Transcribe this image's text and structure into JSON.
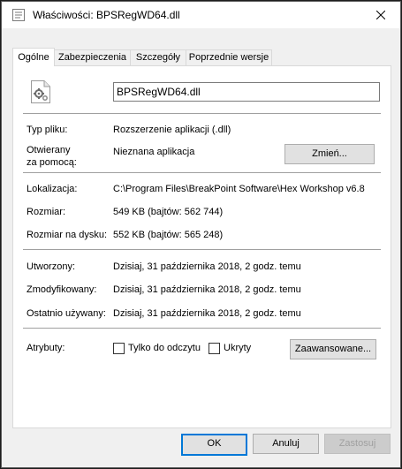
{
  "window": {
    "title": "Właściwości: BPSRegWD64.dll"
  },
  "tabs": [
    {
      "label": "Ogólne",
      "active": true
    },
    {
      "label": "Zabezpieczenia",
      "active": false
    },
    {
      "label": "Szczegóły",
      "active": false
    },
    {
      "label": "Poprzednie wersje",
      "active": false
    }
  ],
  "general": {
    "file_name": "BPSRegWD64.dll",
    "file_icon": "dll-file-icon",
    "type_label": "Typ pliku:",
    "type_value": "Rozszerzenie aplikacji (.dll)",
    "opens_with_label_line1": "Otwierany",
    "opens_with_label_line2": "za pomocą:",
    "opens_with_value": "Nieznana aplikacja",
    "change_button": "Zmień...",
    "location_label": "Lokalizacja:",
    "location_value": "C:\\Program Files\\BreakPoint Software\\Hex Workshop v6.8",
    "size_label": "Rozmiar:",
    "size_value": "549 KB (bajtów: 562 744)",
    "size_on_disk_label": "Rozmiar na dysku:",
    "size_on_disk_value": "552 KB (bajtów: 565 248)",
    "created_label": "Utworzony:",
    "created_value": "Dzisiaj, 31 października 2018, 2 godz. temu",
    "modified_label": "Zmodyfikowany:",
    "modified_value": "Dzisiaj, 31 października 2018, 2 godz. temu",
    "accessed_label": "Ostatnio używany:",
    "accessed_value": "Dzisiaj, 31 października 2018, 2 godz. temu",
    "attributes_label": "Atrybuty:",
    "readonly_label": "Tylko do odczytu",
    "readonly_checked": false,
    "hidden_label": "Ukryty",
    "hidden_checked": false,
    "advanced_button": "Zaawansowane..."
  },
  "footer": {
    "ok": "OK",
    "cancel": "Anuluj",
    "apply": "Zastosuj"
  },
  "colors": {
    "accent": "#0078d7",
    "disabled_text": "#a0a0a0"
  }
}
